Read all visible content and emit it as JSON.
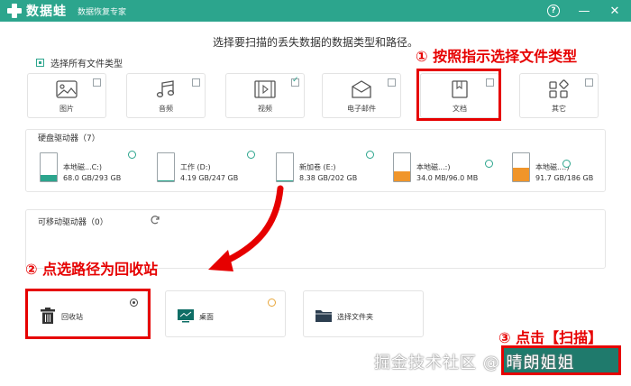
{
  "app": {
    "name": "数据蛙",
    "subtitle": "数据恢复专家",
    "accent_color": "#2ca58d",
    "controls": {
      "help": "?",
      "minimize": "—",
      "close": "✕"
    }
  },
  "prompt": "选择要扫描的丢失数据的数据类型和路径。",
  "select_all": {
    "label": "选择所有文件类型",
    "checked": true
  },
  "file_types": [
    {
      "id": "image",
      "label": "图片",
      "icon": "image-icon",
      "checked": false
    },
    {
      "id": "audio",
      "label": "音频",
      "icon": "music-note-icon",
      "checked": false
    },
    {
      "id": "video",
      "label": "视频",
      "icon": "film-icon",
      "checked": true
    },
    {
      "id": "email",
      "label": "电子邮件",
      "icon": "envelope-icon",
      "checked": false
    },
    {
      "id": "doc",
      "label": "文档",
      "icon": "bookmark-document-icon",
      "checked": false
    },
    {
      "id": "other",
      "label": "其它",
      "icon": "grid-shapes-icon",
      "checked": false
    }
  ],
  "hard_drives": {
    "title": "硬盘驱动器（7）",
    "items": [
      {
        "name": "本地磁...C:)",
        "size": "68.0 GB/293 GB",
        "used_fraction": 0.23,
        "fill_color": "#2ca58d"
      },
      {
        "name": "工作 (D:)",
        "size": "4.19 GB/247 GB",
        "used_fraction": 0.02,
        "fill_color": "#2ca58d"
      },
      {
        "name": "新加卷 (E:)",
        "size": "8.38 GB/202 GB",
        "used_fraction": 0.04,
        "fill_color": "#2ca58d"
      },
      {
        "name": "本地磁...:)",
        "size": "34.0 MB/96.0 MB",
        "used_fraction": 0.35,
        "fill_color": "#f0952a"
      },
      {
        "name": "本地磁...:)",
        "size": "91.7 GB/186 GB",
        "used_fraction": 0.49,
        "fill_color": "#f0952a"
      }
    ]
  },
  "removable": {
    "title": "可移动驱动器（0）"
  },
  "locations": [
    {
      "id": "recycle",
      "label": "回收站",
      "icon": "trash-icon",
      "selected": true
    },
    {
      "id": "desktop",
      "label": "桌面",
      "icon": "monitor-icon",
      "selected": false
    },
    {
      "id": "folder",
      "label": "选择文件夹",
      "icon": "folder-icon",
      "selected": false
    }
  ],
  "annotations": {
    "step1": "① 按照指示选择文件类型",
    "step2": "② 点选路径为回收站",
    "step3": "③ 点击【扫描】",
    "highlight_color": "#e60000"
  },
  "watermark": "掘金技术社区 @ 晴朗姐姐"
}
